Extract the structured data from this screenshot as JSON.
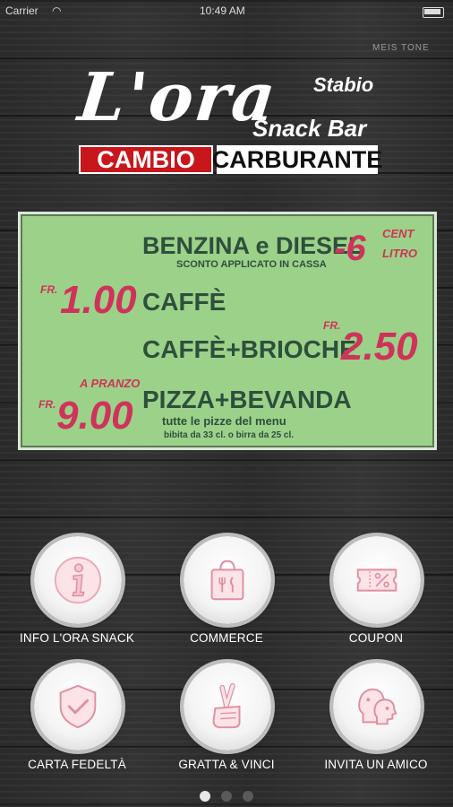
{
  "status_bar": {
    "carrier": "Carrier",
    "time": "10:49 AM"
  },
  "header": {
    "logo_name": "L'ora",
    "logo_location": "Stabio",
    "logo_subtitle": "Snack Bar",
    "corner_mark": "MEIS TONE",
    "banner_left": "CAMBIO",
    "banner_right": "CARBURANTE"
  },
  "promo": {
    "fuel_title": "BENZINA e DIESEL",
    "fuel_note": "SCONTO APPLICATO IN CASSA",
    "fuel_discount": "-6",
    "fuel_unit_top": "CENT",
    "fuel_unit_bottom": "LITRO",
    "item1_currency": "FR.",
    "item1_price": "1.00",
    "item1_name": "CAFFÈ",
    "item2_name": "CAFFÈ+BRIOCHE",
    "item2_currency": "FR.",
    "item2_price": "2.50",
    "item3_tag": "A PRANZO",
    "item3_currency": "FR.",
    "item3_price": "9.00",
    "item3_name": "PIZZA+BEVANDA",
    "item3_note": "tutte le pizze del menu",
    "item3_note2": "bibita da 33 cl. o birra da 25 cl."
  },
  "tiles": [
    {
      "label": "INFO L'ORA SNACK",
      "icon": "info-icon"
    },
    {
      "label": "COMMERCE",
      "icon": "shopping-bag-icon"
    },
    {
      "label": "COUPON",
      "icon": "coupon-icon"
    },
    {
      "label": "CARTA FEDELTÀ",
      "icon": "shield-check-icon"
    },
    {
      "label": "GRATTA & VINCI",
      "icon": "crossed-fingers-icon"
    },
    {
      "label": "INVITA UN AMICO",
      "icon": "people-icon"
    }
  ],
  "pager": {
    "count": 3,
    "active": 1
  },
  "colors": {
    "accent_pink": "#d0335a",
    "board_green": "#9bd189",
    "banner_red": "#c8171c"
  }
}
